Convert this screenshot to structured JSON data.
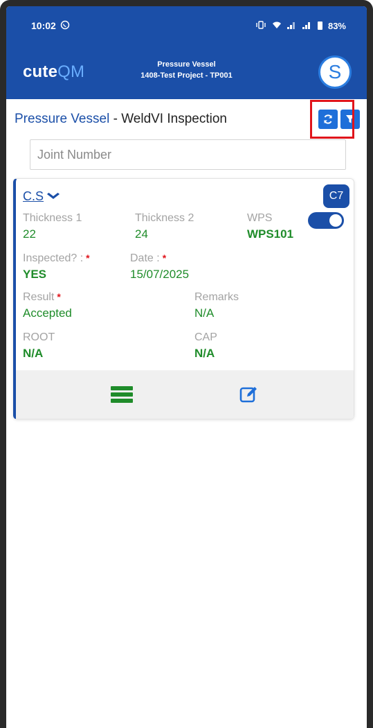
{
  "status_bar": {
    "time": "10:02",
    "battery": "83%"
  },
  "header": {
    "brand_prefix": "cute",
    "brand_suffix": "QM",
    "title_line1": "Pressure Vessel",
    "title_line2": "1408-Test Project - TP001",
    "avatar_letter": "S"
  },
  "page": {
    "module": "Pressure Vessel",
    "separator": " - ",
    "title": "WeldVI Inspection"
  },
  "search": {
    "placeholder": "Joint Number",
    "value": ""
  },
  "card": {
    "group": "C.S",
    "badge": "C7",
    "fields": {
      "thickness1": {
        "label": "Thickness 1",
        "value": "22"
      },
      "thickness2": {
        "label": "Thickness 2",
        "value": "24"
      },
      "wps": {
        "label": "WPS",
        "value": "WPS101",
        "toggle_on": true
      },
      "inspected": {
        "label": "Inspected? :",
        "value": "YES"
      },
      "date": {
        "label": "Date :",
        "value": "15/07/2025"
      },
      "result": {
        "label": "Result",
        "value": "Accepted"
      },
      "remarks": {
        "label": "Remarks",
        "value": "N/A"
      },
      "root": {
        "label": "ROOT",
        "value": "N/A"
      },
      "cap": {
        "label": "CAP",
        "value": "N/A"
      }
    }
  },
  "icons": {
    "status": [
      "whatsapp-icon",
      "wifi-icon",
      "signal-icon",
      "battery-icon"
    ],
    "title_actions": [
      "refresh-icon",
      "filter-icon"
    ],
    "card_footer": [
      "list-icon",
      "edit-icon"
    ]
  },
  "colors": {
    "primary": "#1b4fa8",
    "accent": "#1e6fd9",
    "value_green": "#1f8c2a",
    "label_gray": "#a3a3a3",
    "highlight_red": "#e0141b"
  }
}
